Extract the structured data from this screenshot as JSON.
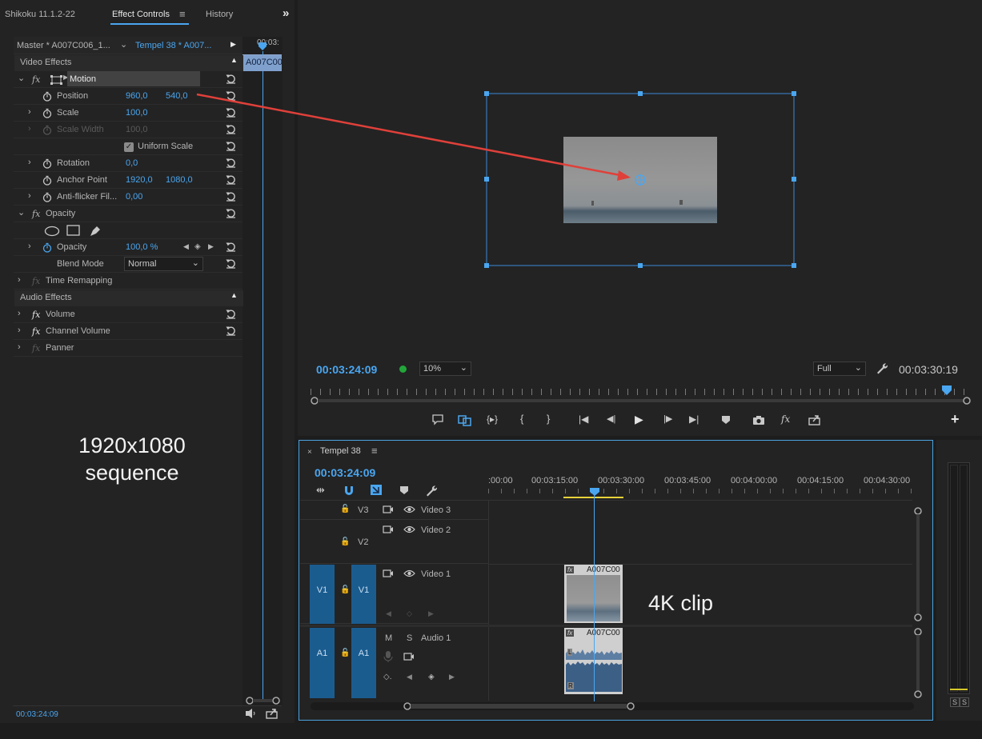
{
  "ec": {
    "app_title": "Shikoku 11.1.2-22",
    "tab_effect_controls": "Effect Controls",
    "tab_history": "History",
    "master_label": "Master * A007C006_1...",
    "sequence_label": "Tempel 38 * A007...",
    "mini_time": "00:03:",
    "mini_clip": "A007C00",
    "video_effects": "Video Effects",
    "audio_effects": "Audio Effects",
    "motion": "Motion",
    "position_label": "Position",
    "position_x": "960,0",
    "position_y": "540,0",
    "scale_label": "Scale",
    "scale_value": "100,0",
    "scale_width_label": "Scale Width",
    "scale_width_value": "100,0",
    "uniform_scale": "Uniform Scale",
    "rotation_label": "Rotation",
    "rotation_value": "0,0",
    "anchor_label": "Anchor Point",
    "anchor_x": "1920,0",
    "anchor_y": "1080,0",
    "antiflicker_label": "Anti-flicker Fil...",
    "antiflicker_value": "0,00",
    "opacity_section": "Opacity",
    "opacity_label": "Opacity",
    "opacity_value": "100,0 %",
    "blend_label": "Blend Mode",
    "blend_value": "Normal",
    "time_remapping": "Time Remapping",
    "volume": "Volume",
    "channel_volume": "Channel Volume",
    "panner": "Panner",
    "fx": "fx",
    "timecode": "00:03:24:09"
  },
  "annotations": {
    "sequence_line1": "1920x1080",
    "sequence_line2": "sequence",
    "clip": "4K clip"
  },
  "program": {
    "timecode": "00:03:24:09",
    "zoom": "10%",
    "quality": "Full",
    "duration": "00:03:30:19"
  },
  "timeline": {
    "tab": "Tempel 38",
    "timecode": "00:03:24:09",
    "ruler": [
      ":00:00",
      "00:03:15:00",
      "00:03:30:00",
      "00:03:45:00",
      "00:04:00:00",
      "00:04:15:00",
      "00:04:30:00"
    ],
    "v3": "V3",
    "video3": "Video 3",
    "v2": "V2",
    "video2": "Video 2",
    "v1": "V1",
    "video1": "Video 1",
    "a1": "A1",
    "audio1": "Audio 1",
    "m": "M",
    "s": "S",
    "clip_name": "A007C00",
    "clip_fx": "fx",
    "l": "L",
    "r": "R"
  },
  "meter": {
    "s1": "S",
    "s2": "S"
  },
  "colors": {
    "accent": "#4aa6f0",
    "track_blue": "#1b5c8f",
    "arrow": "#e0403a"
  }
}
